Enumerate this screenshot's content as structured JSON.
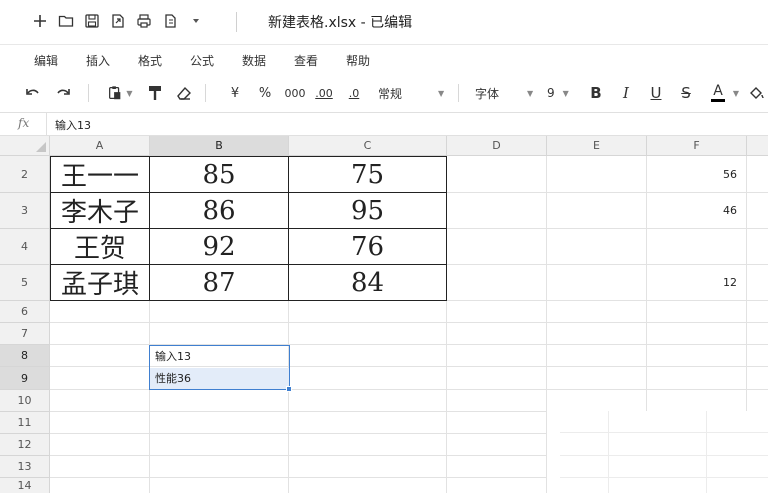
{
  "titlebar": {
    "doc_title": "新建表格.xlsx - 已编辑",
    "icons": [
      "plus-icon",
      "folder-icon",
      "save-icon",
      "export-icon",
      "print-icon",
      "copy-icon",
      "more-dropdown-icon"
    ]
  },
  "menu": {
    "items": [
      "编辑",
      "插入",
      "格式",
      "公式",
      "数据",
      "查看",
      "帮助"
    ]
  },
  "toolbar": {
    "currency": "¥",
    "percent": "%",
    "thousands": "000",
    "dec_increase": ".00",
    "dec_decrease": ".0",
    "number_format": "常规",
    "font_name": "字体",
    "font_size": "9",
    "bold": "B",
    "italic": "I",
    "underline": "U",
    "strike": "S",
    "font_color": "A",
    "font_color_value": "#000000"
  },
  "formula_bar": {
    "fx_label": "fx",
    "value": "输入13"
  },
  "grid": {
    "columns": [
      "A",
      "B",
      "C",
      "D",
      "E",
      "F"
    ],
    "rows": [
      "2",
      "3",
      "4",
      "5",
      "6",
      "7",
      "8",
      "9",
      "10",
      "11",
      "12",
      "13",
      "14"
    ],
    "selected_column": "B",
    "selected_rows": [
      "8",
      "9"
    ],
    "table": [
      [
        "王一一",
        "85",
        "75"
      ],
      [
        "李木子",
        "86",
        "95"
      ],
      [
        "王贺",
        "92",
        "76"
      ],
      [
        "孟子琪",
        "87",
        "84"
      ]
    ],
    "column_f": [
      "56",
      "46",
      "",
      "12"
    ],
    "b8": "输入13",
    "b9": "性能36",
    "selection_color": "#3f7fd0"
  }
}
